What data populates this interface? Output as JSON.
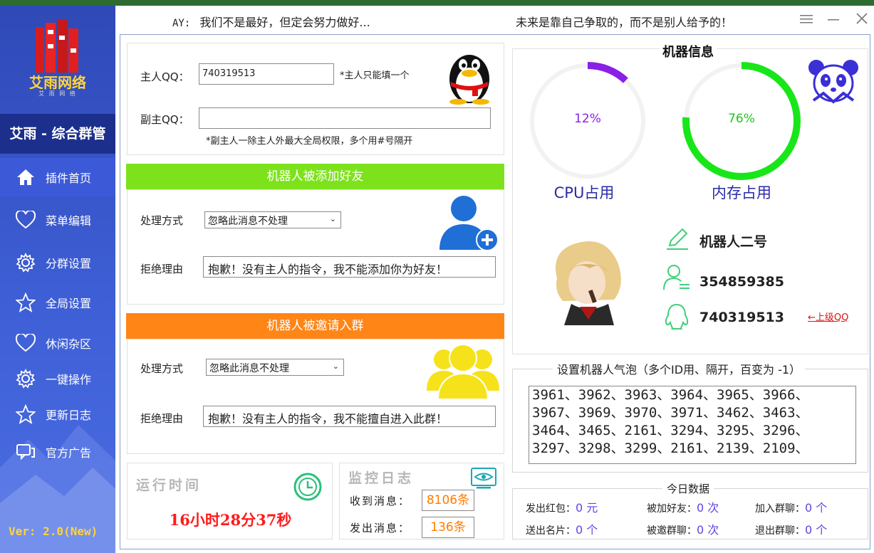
{
  "app": {
    "name": "艾雨网络",
    "subtitle": "艾 雨 网 络",
    "title": "艾雨 - 综合群管",
    "version": "Ver: 2.0(New)"
  },
  "header": {
    "ay_prefix": "AY:",
    "motto_left": "我们不是最好，但定会努力做好...",
    "motto_right": "未来是靠自己争取的，而不是别人给予的！"
  },
  "sidebar": {
    "items": [
      {
        "label": "插件首页",
        "icon": "home-icon"
      },
      {
        "label": "菜单编辑",
        "icon": "heart-icon"
      },
      {
        "label": "分群设置",
        "icon": "gear-icon"
      },
      {
        "label": "全局设置",
        "icon": "star-icon"
      },
      {
        "label": "休闲杂区",
        "icon": "heart-icon"
      },
      {
        "label": "一键操作",
        "icon": "gear-icon"
      },
      {
        "label": "更新日志",
        "icon": "star-icon"
      },
      {
        "label": "官方广告",
        "icon": "chat-icon"
      }
    ]
  },
  "owner": {
    "main_label": "主人QQ：",
    "main_value": "740319513",
    "main_hint": "*主人只能填一个",
    "sub_label": "副主QQ：",
    "sub_value": "",
    "sub_hint": "*副主人一除主人外最大全局权限，多个用#号隔开"
  },
  "friend": {
    "band": "机器人被添加好友",
    "method_label": "处理方式",
    "method_value": "忽略此消息不处理",
    "reason_label": "拒绝理由",
    "reason_value": "抱歉！没有主人的指令，我不能添加你为好友！"
  },
  "invite": {
    "band": "机器人被邀请入群",
    "method_label": "处理方式",
    "method_value": "忽略此消息不处理",
    "reason_label": "拒绝理由",
    "reason_value": "抱歉！没有主人的指令，我不能擅自进入此群！"
  },
  "runtime": {
    "title": "运行时间",
    "value": "16小时28分37秒"
  },
  "monitor": {
    "title": "监控日志",
    "received_label": "收到消息：",
    "received_value": "8106条",
    "sent_label": "发出消息：",
    "sent_value": "136条"
  },
  "machine": {
    "title": "机器信息",
    "cpu": {
      "label": "CPU占用",
      "text": "12%",
      "percent": 12,
      "color": "#8a20e6"
    },
    "mem": {
      "label": "内存占用",
      "text": "76%",
      "percent": 76,
      "color": "#19e619"
    },
    "bot_name": "机器人二号",
    "bot_qq": "354859385",
    "owner_qq": "740319513",
    "owner_link": "←上级QQ"
  },
  "bubble": {
    "legend": "设置机器人气泡（多个ID用、隔开，百变为 -1）",
    "value": "3961、3962、3963、3964、3965、3966、3967、3969、3970、3971、3462、3463、3464、3465、2161、3294、3295、3296、3297、3298、3299、2161、2139、2109、"
  },
  "today": {
    "title": "今日数据",
    "red_packet_label": "发出红包：",
    "red_packet_value": "0 元",
    "added_friend_label": "被加好友：",
    "added_friend_value": "0 次",
    "joined_group_label": "加入群聊：",
    "joined_group_value": "0 个",
    "card_label": "送出名片：",
    "card_value": "0 个",
    "invited_label": "被邀群聊：",
    "invited_value": "0 次",
    "left_group_label": "退出群聊：",
    "left_group_value": "0 个"
  },
  "colors": {
    "friend_band": "#7de21c",
    "invite_band": "#ff8517",
    "runtime": "#ff1a1a",
    "accent": "#5a48e6"
  }
}
